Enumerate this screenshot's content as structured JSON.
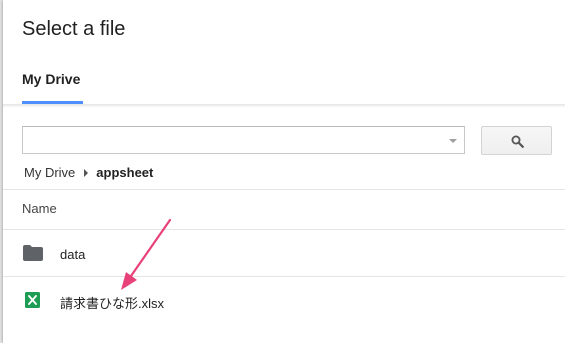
{
  "dialog": {
    "title": "Select a file",
    "tabs": [
      {
        "label": "My Drive",
        "active": true
      }
    ]
  },
  "search": {
    "value": "",
    "placeholder": "",
    "button_icon": "search-icon"
  },
  "breadcrumb": {
    "items": [
      "My Drive",
      "appsheet"
    ]
  },
  "file_list": {
    "column_header": "Name",
    "items": [
      {
        "name": "data",
        "type": "folder",
        "icon": "folder-icon"
      },
      {
        "name": "請求書ひな形.xlsx",
        "type": "excel",
        "icon": "excel-file-icon"
      }
    ]
  },
  "colors": {
    "tab_underline": "#4d90fe",
    "annotation_arrow": "#e8417a",
    "excel_green": "#1e9e54",
    "folder_gray": "#5f6368"
  }
}
